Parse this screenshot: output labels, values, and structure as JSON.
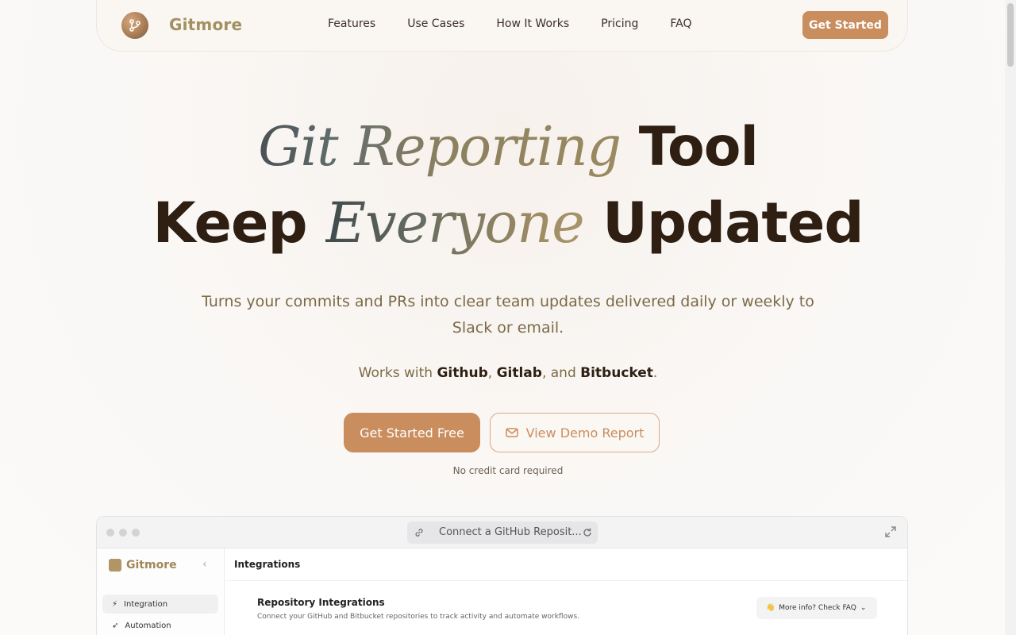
{
  "brand": {
    "name": "Gitmore"
  },
  "nav": {
    "links": [
      "Features",
      "Use Cases",
      "How It Works",
      "Pricing",
      "FAQ"
    ],
    "cta": "Get Started"
  },
  "hero": {
    "line1_accent": "Git Reporting",
    "line1_rest": "Tool",
    "line2_lead": "Keep",
    "line2_accent": "Everyone",
    "line2_rest": "Updated",
    "subtitle": "Turns your commits and PRs into clear team updates delivered daily or weekly to Slack or email.",
    "works_prefix": "Works with",
    "providers": [
      "Github",
      "Gitlab",
      "Bitbucket"
    ],
    "works_and": "and",
    "primary_cta": "Get Started Free",
    "secondary_cta": "View Demo Report",
    "note": "No credit card required"
  },
  "preview": {
    "url_text": "Connect a GitHub Reposit...",
    "sidebar_brand": "Gitmore",
    "sidebar_items": [
      "Integration",
      "Automation"
    ],
    "page_title": "Integrations",
    "card_title": "Repository Integrations",
    "card_subtitle": "Connect your GitHub and Bitbucket repositories to track activity and automate workflows.",
    "faq_button": "More info? Check FAQ"
  },
  "colors": {
    "accent": "#c98d5e",
    "text_dark": "#2e1f12",
    "muted": "#7b6a45"
  }
}
